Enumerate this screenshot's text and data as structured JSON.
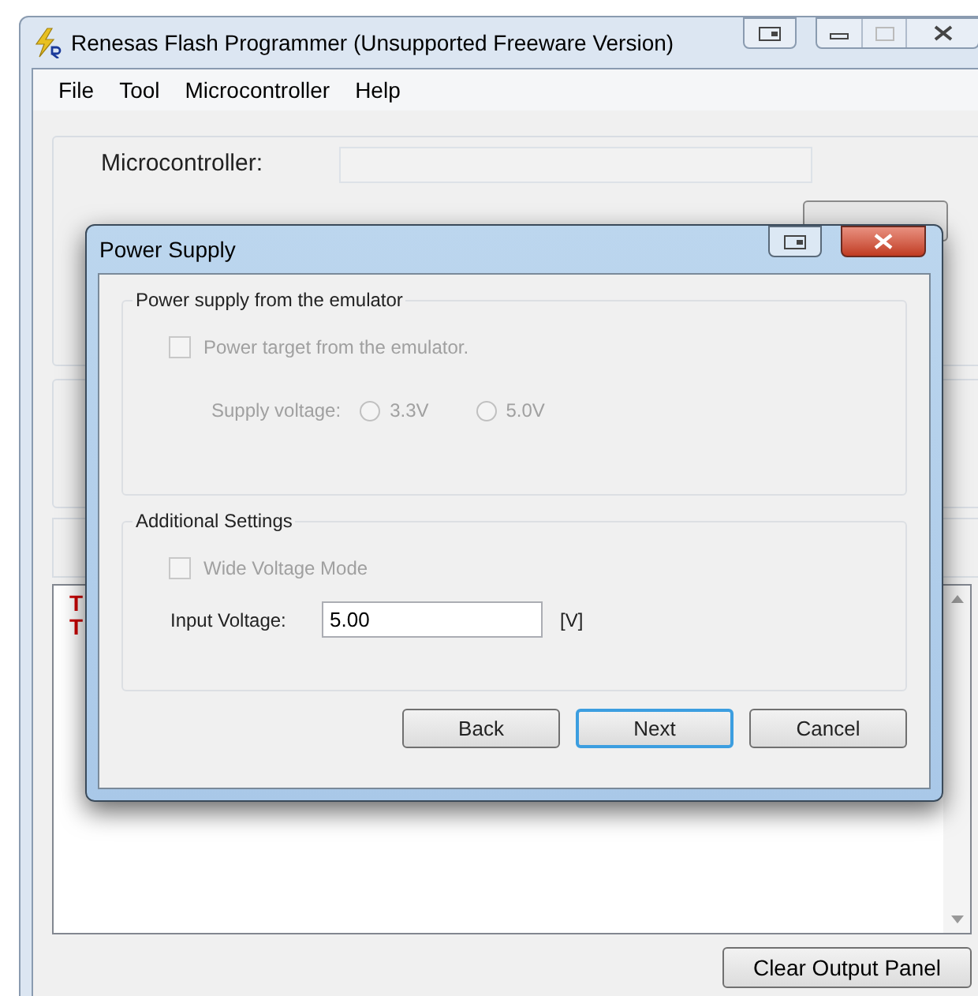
{
  "window": {
    "title": "Renesas Flash Programmer (Unsupported Freeware Version)"
  },
  "menu": [
    "File",
    "Tool",
    "Microcontroller",
    "Help"
  ],
  "main": {
    "microcontroller_label": "Microcontroller:",
    "output_lines": [
      "T",
      "T"
    ],
    "clear_button": "Clear Output Panel"
  },
  "dialog": {
    "title": "Power Supply",
    "emulator_group": {
      "legend": "Power supply from the emulator",
      "checkbox": {
        "label": "Power target from the emulator.",
        "checked": false,
        "disabled": true
      },
      "supply_voltage": {
        "label": "Supply voltage:",
        "disabled": true,
        "options": [
          {
            "label": "3.3V",
            "selected": false
          },
          {
            "label": "5.0V",
            "selected": false
          }
        ]
      }
    },
    "additional_group": {
      "legend": "Additional Settings",
      "checkbox": {
        "label": "Wide Voltage Mode",
        "checked": false,
        "disabled": true
      },
      "input_voltage": {
        "label": "Input Voltage:",
        "value": "5.00",
        "unit": "[V]"
      }
    },
    "buttons": [
      {
        "label": "Back",
        "default": false
      },
      {
        "label": "Next",
        "default": true
      },
      {
        "label": "Cancel",
        "default": false
      }
    ]
  }
}
